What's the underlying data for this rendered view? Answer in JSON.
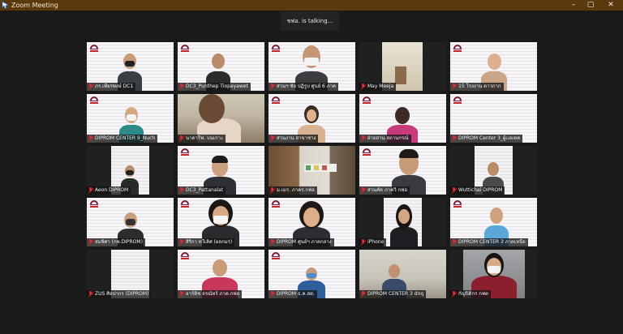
{
  "window": {
    "title": "Zoom Meeting",
    "controls": {
      "minimize": "–",
      "maximize": "▢",
      "close": "✕"
    },
    "title_bar_color": "#5a3a0c"
  },
  "speaker_indicator": {
    "text": "ชฟอ. is talking..."
  },
  "colors": {
    "muted_icon": "#e22233",
    "banner": "#f6f6f8",
    "background": "#1a1a1a"
  },
  "participants": [
    {
      "name": "ภร.เพียรพงษ์ DC1"
    },
    {
      "name": "DC3_Punthep Tiopayawet"
    },
    {
      "name": "ส่วนฯ ชัย ปฏิรูป ศูนย์ 6 ภาค"
    },
    {
      "name": "May Meeja"
    },
    {
      "name": "15 โรงงาน ดาวกาก"
    },
    {
      "name": "DIPROM CENTER 9_Nuch"
    },
    {
      "name": "นาดารีฟ. บนเกาะ"
    },
    {
      "name": "ส่วนงาน สาขาช่าง"
    },
    {
      "name": "ฝ่ายสาน สถานกรณ์"
    },
    {
      "name": "DIPROM Center 3_ผู้เเลเทค"
    },
    {
      "name": "Aeon DIPROM"
    },
    {
      "name": "DC3_Pattanalat"
    },
    {
      "name": "ม.เมร. ภาคร.กฟอ"
    },
    {
      "name": "ส่วนคัด ภาควิ กฟอ"
    },
    {
      "name": "Wuttichai DIPROM"
    },
    {
      "name": "สมพิศา (กพ.DIPROM)"
    },
    {
      "name": "สิริกา ทวีเลิศ (ผลกมร)"
    },
    {
      "name": "DIPROM ศูนย์ฯ ภาคกลาง"
    },
    {
      "name": "iPhone"
    },
    {
      "name": "DIPROM CENTER 3 ภาคเหนือ"
    },
    {
      "name": "ZUS ศิลปากร (DIPROM)"
    },
    {
      "name": "อาร์ติช จรณัทร์ ภาค.กฟอ"
    },
    {
      "name": "DIPROM ธ.ค.สต."
    },
    {
      "name": "DIPROM CENTER 3 dnq"
    },
    {
      "name": "กัญปิติกร กฟต"
    }
  ]
}
